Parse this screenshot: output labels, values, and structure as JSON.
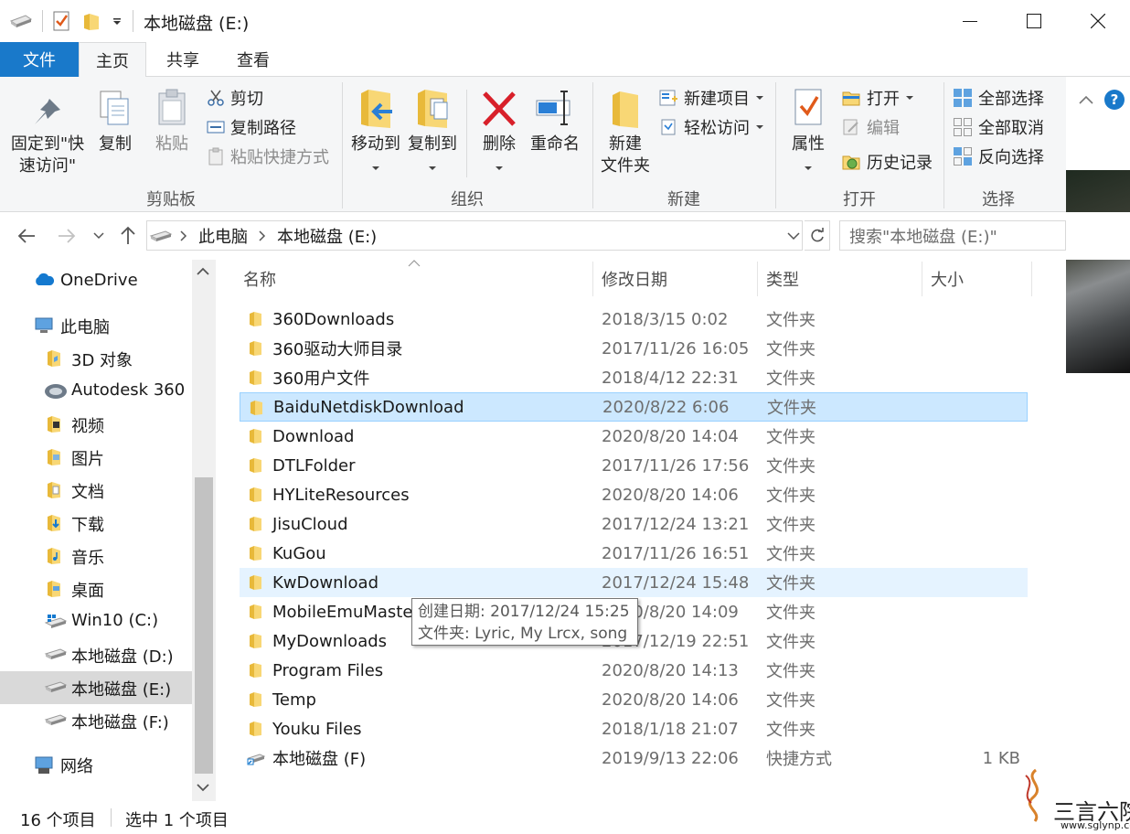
{
  "window": {
    "title": "本地磁盘 (E:)"
  },
  "tabs": {
    "file": "文件",
    "home": "主页",
    "share": "共享",
    "view": "查看"
  },
  "ribbon": {
    "clipboard": {
      "label": "剪贴板",
      "pin_line1": "固定到\"快",
      "pin_line2": "速访问\"",
      "copy": "复制",
      "paste": "粘贴",
      "cut": "剪切",
      "copy_path": "复制路径",
      "paste_shortcut": "粘贴快捷方式"
    },
    "organize": {
      "label": "组织",
      "move_to": "移动到",
      "copy_to": "复制到",
      "delete": "删除",
      "rename": "重命名"
    },
    "new": {
      "label": "新建",
      "new_folder_line1": "新建",
      "new_folder_line2": "文件夹",
      "new_item": "新建项目",
      "easy_access": "轻松访问"
    },
    "open": {
      "label": "打开",
      "properties": "属性",
      "open": "打开",
      "edit": "编辑",
      "history": "历史记录"
    },
    "select": {
      "label": "选择",
      "select_all": "全部选择",
      "select_none": "全部取消",
      "invert": "反向选择"
    }
  },
  "address": {
    "crumb1": "此电脑",
    "crumb2": "本地磁盘 (E:)",
    "search_placeholder": "搜索\"本地磁盘 (E:)\""
  },
  "nav": [
    {
      "label": "OneDrive",
      "icon": "cloud-icon"
    },
    {
      "label": "此电脑",
      "icon": "computer-icon"
    },
    {
      "label": "3D 对象",
      "icon": "folder-3d-icon"
    },
    {
      "label": "Autodesk 360",
      "icon": "autodesk-icon"
    },
    {
      "label": "视频",
      "icon": "video-folder-icon"
    },
    {
      "label": "图片",
      "icon": "pictures-folder-icon"
    },
    {
      "label": "文档",
      "icon": "documents-folder-icon"
    },
    {
      "label": "下载",
      "icon": "downloads-folder-icon"
    },
    {
      "label": "音乐",
      "icon": "music-folder-icon"
    },
    {
      "label": "桌面",
      "icon": "desktop-folder-icon"
    },
    {
      "label": "Win10 (C:)",
      "icon": "windows-drive-icon"
    },
    {
      "label": "本地磁盘 (D:)",
      "icon": "drive-icon"
    },
    {
      "label": "本地磁盘 (E:)",
      "icon": "drive-icon"
    },
    {
      "label": "本地磁盘 (F:)",
      "icon": "drive-icon"
    },
    {
      "label": "网络",
      "icon": "network-icon"
    }
  ],
  "columns": {
    "name": "名称",
    "date": "修改日期",
    "type": "类型",
    "size": "大小"
  },
  "files": [
    {
      "name": "360Downloads",
      "date": "2018/3/15 0:02",
      "type": "文件夹",
      "size": ""
    },
    {
      "name": "360驱动大师目录",
      "date": "2017/11/26 16:05",
      "type": "文件夹",
      "size": ""
    },
    {
      "name": "360用户文件",
      "date": "2018/4/12 22:31",
      "type": "文件夹",
      "size": ""
    },
    {
      "name": "BaiduNetdiskDownload",
      "date": "2020/8/22 6:06",
      "type": "文件夹",
      "size": ""
    },
    {
      "name": "Download",
      "date": "2020/8/20 14:04",
      "type": "文件夹",
      "size": ""
    },
    {
      "name": "DTLFolder",
      "date": "2017/11/26 17:56",
      "type": "文件夹",
      "size": ""
    },
    {
      "name": "HYLiteResources",
      "date": "2020/8/20 14:06",
      "type": "文件夹",
      "size": ""
    },
    {
      "name": "JisuCloud",
      "date": "2017/12/24 13:21",
      "type": "文件夹",
      "size": ""
    },
    {
      "name": "KuGou",
      "date": "2017/11/26 16:51",
      "type": "文件夹",
      "size": ""
    },
    {
      "name": "KwDownload",
      "date": "2017/12/24 15:48",
      "type": "文件夹",
      "size": ""
    },
    {
      "name": "MobileEmuMaste",
      "date": "2020/8/20 14:09",
      "type": "文件夹",
      "size": ""
    },
    {
      "name": "MyDownloads",
      "date": "2017/12/19 22:51",
      "type": "文件夹",
      "size": ""
    },
    {
      "name": "Program Files",
      "date": "2020/8/20 14:13",
      "type": "文件夹",
      "size": ""
    },
    {
      "name": "Temp",
      "date": "2020/8/20 14:06",
      "type": "文件夹",
      "size": ""
    },
    {
      "name": "Youku Files",
      "date": "2018/1/18 21:07",
      "type": "文件夹",
      "size": ""
    },
    {
      "name": "本地磁盘 (F)",
      "date": "2019/9/13 22:06",
      "type": "快捷方式",
      "size": "1 KB"
    }
  ],
  "tooltip": {
    "line1": "创建日期: 2017/12/24 15:25",
    "line2": "文件夹: Lyric, My Lrcx, song"
  },
  "status": {
    "count": "16 个项目",
    "selected": "选中 1 个项目"
  },
  "watermark": {
    "text": "三言六院",
    "url": "www.sglynp.com"
  },
  "colors": {
    "accent": "#1979ca",
    "selection": "#cce8ff",
    "folder": "#f8d775"
  }
}
